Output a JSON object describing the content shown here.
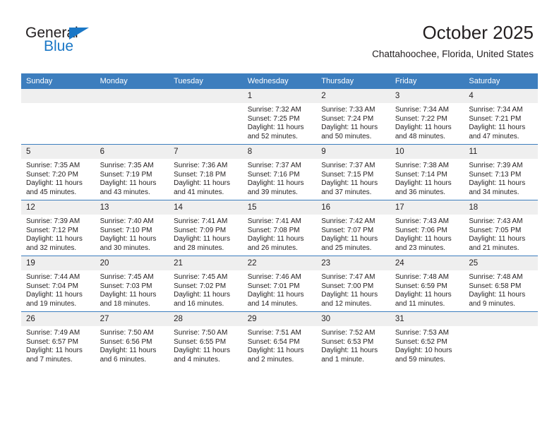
{
  "brand": {
    "name_part1": "General",
    "name_part2": "Blue"
  },
  "header": {
    "title": "October 2025",
    "subtitle": "Chattahoochee, Florida, United States"
  },
  "colors": {
    "header_blue": "#3d7ebe",
    "daynum_band": "#efefef",
    "text": "#231f20",
    "logo_blue": "#1a77c6"
  },
  "weekdays": [
    "Sunday",
    "Monday",
    "Tuesday",
    "Wednesday",
    "Thursday",
    "Friday",
    "Saturday"
  ],
  "weeks": [
    [
      {
        "empty": true
      },
      {
        "empty": true
      },
      {
        "empty": true
      },
      {
        "day": "1",
        "sunrise": "Sunrise: 7:32 AM",
        "sunset": "Sunset: 7:25 PM",
        "daylight": "Daylight: 11 hours and 52 minutes."
      },
      {
        "day": "2",
        "sunrise": "Sunrise: 7:33 AM",
        "sunset": "Sunset: 7:24 PM",
        "daylight": "Daylight: 11 hours and 50 minutes."
      },
      {
        "day": "3",
        "sunrise": "Sunrise: 7:34 AM",
        "sunset": "Sunset: 7:22 PM",
        "daylight": "Daylight: 11 hours and 48 minutes."
      },
      {
        "day": "4",
        "sunrise": "Sunrise: 7:34 AM",
        "sunset": "Sunset: 7:21 PM",
        "daylight": "Daylight: 11 hours and 47 minutes."
      }
    ],
    [
      {
        "day": "5",
        "sunrise": "Sunrise: 7:35 AM",
        "sunset": "Sunset: 7:20 PM",
        "daylight": "Daylight: 11 hours and 45 minutes."
      },
      {
        "day": "6",
        "sunrise": "Sunrise: 7:35 AM",
        "sunset": "Sunset: 7:19 PM",
        "daylight": "Daylight: 11 hours and 43 minutes."
      },
      {
        "day": "7",
        "sunrise": "Sunrise: 7:36 AM",
        "sunset": "Sunset: 7:18 PM",
        "daylight": "Daylight: 11 hours and 41 minutes."
      },
      {
        "day": "8",
        "sunrise": "Sunrise: 7:37 AM",
        "sunset": "Sunset: 7:16 PM",
        "daylight": "Daylight: 11 hours and 39 minutes."
      },
      {
        "day": "9",
        "sunrise": "Sunrise: 7:37 AM",
        "sunset": "Sunset: 7:15 PM",
        "daylight": "Daylight: 11 hours and 37 minutes."
      },
      {
        "day": "10",
        "sunrise": "Sunrise: 7:38 AM",
        "sunset": "Sunset: 7:14 PM",
        "daylight": "Daylight: 11 hours and 36 minutes."
      },
      {
        "day": "11",
        "sunrise": "Sunrise: 7:39 AM",
        "sunset": "Sunset: 7:13 PM",
        "daylight": "Daylight: 11 hours and 34 minutes."
      }
    ],
    [
      {
        "day": "12",
        "sunrise": "Sunrise: 7:39 AM",
        "sunset": "Sunset: 7:12 PM",
        "daylight": "Daylight: 11 hours and 32 minutes."
      },
      {
        "day": "13",
        "sunrise": "Sunrise: 7:40 AM",
        "sunset": "Sunset: 7:10 PM",
        "daylight": "Daylight: 11 hours and 30 minutes."
      },
      {
        "day": "14",
        "sunrise": "Sunrise: 7:41 AM",
        "sunset": "Sunset: 7:09 PM",
        "daylight": "Daylight: 11 hours and 28 minutes."
      },
      {
        "day": "15",
        "sunrise": "Sunrise: 7:41 AM",
        "sunset": "Sunset: 7:08 PM",
        "daylight": "Daylight: 11 hours and 26 minutes."
      },
      {
        "day": "16",
        "sunrise": "Sunrise: 7:42 AM",
        "sunset": "Sunset: 7:07 PM",
        "daylight": "Daylight: 11 hours and 25 minutes."
      },
      {
        "day": "17",
        "sunrise": "Sunrise: 7:43 AM",
        "sunset": "Sunset: 7:06 PM",
        "daylight": "Daylight: 11 hours and 23 minutes."
      },
      {
        "day": "18",
        "sunrise": "Sunrise: 7:43 AM",
        "sunset": "Sunset: 7:05 PM",
        "daylight": "Daylight: 11 hours and 21 minutes."
      }
    ],
    [
      {
        "day": "19",
        "sunrise": "Sunrise: 7:44 AM",
        "sunset": "Sunset: 7:04 PM",
        "daylight": "Daylight: 11 hours and 19 minutes."
      },
      {
        "day": "20",
        "sunrise": "Sunrise: 7:45 AM",
        "sunset": "Sunset: 7:03 PM",
        "daylight": "Daylight: 11 hours and 18 minutes."
      },
      {
        "day": "21",
        "sunrise": "Sunrise: 7:45 AM",
        "sunset": "Sunset: 7:02 PM",
        "daylight": "Daylight: 11 hours and 16 minutes."
      },
      {
        "day": "22",
        "sunrise": "Sunrise: 7:46 AM",
        "sunset": "Sunset: 7:01 PM",
        "daylight": "Daylight: 11 hours and 14 minutes."
      },
      {
        "day": "23",
        "sunrise": "Sunrise: 7:47 AM",
        "sunset": "Sunset: 7:00 PM",
        "daylight": "Daylight: 11 hours and 12 minutes."
      },
      {
        "day": "24",
        "sunrise": "Sunrise: 7:48 AM",
        "sunset": "Sunset: 6:59 PM",
        "daylight": "Daylight: 11 hours and 11 minutes."
      },
      {
        "day": "25",
        "sunrise": "Sunrise: 7:48 AM",
        "sunset": "Sunset: 6:58 PM",
        "daylight": "Daylight: 11 hours and 9 minutes."
      }
    ],
    [
      {
        "day": "26",
        "sunrise": "Sunrise: 7:49 AM",
        "sunset": "Sunset: 6:57 PM",
        "daylight": "Daylight: 11 hours and 7 minutes."
      },
      {
        "day": "27",
        "sunrise": "Sunrise: 7:50 AM",
        "sunset": "Sunset: 6:56 PM",
        "daylight": "Daylight: 11 hours and 6 minutes."
      },
      {
        "day": "28",
        "sunrise": "Sunrise: 7:50 AM",
        "sunset": "Sunset: 6:55 PM",
        "daylight": "Daylight: 11 hours and 4 minutes."
      },
      {
        "day": "29",
        "sunrise": "Sunrise: 7:51 AM",
        "sunset": "Sunset: 6:54 PM",
        "daylight": "Daylight: 11 hours and 2 minutes."
      },
      {
        "day": "30",
        "sunrise": "Sunrise: 7:52 AM",
        "sunset": "Sunset: 6:53 PM",
        "daylight": "Daylight: 11 hours and 1 minute."
      },
      {
        "day": "31",
        "sunrise": "Sunrise: 7:53 AM",
        "sunset": "Sunset: 6:52 PM",
        "daylight": "Daylight: 10 hours and 59 minutes."
      },
      {
        "empty": true
      }
    ]
  ]
}
